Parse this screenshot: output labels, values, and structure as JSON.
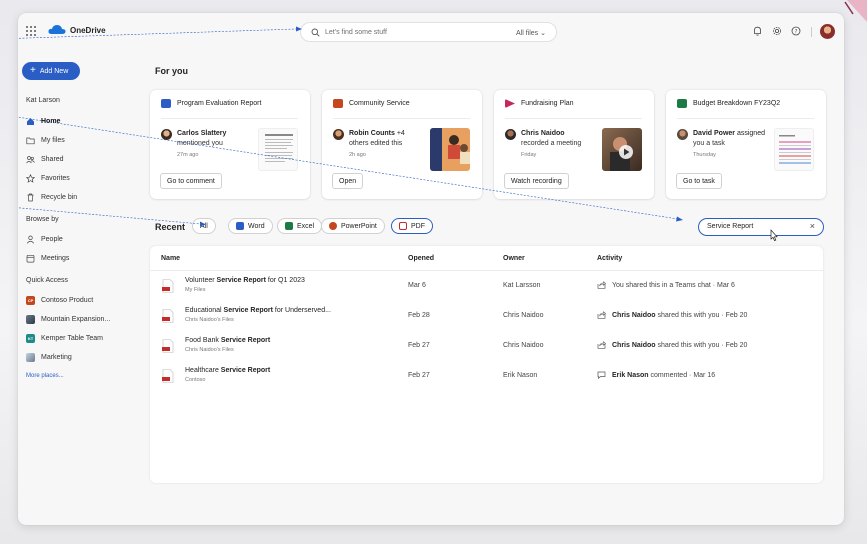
{
  "header": {
    "brand": "OneDrive",
    "search_placeholder": "Let's find some stuff",
    "search_scope": "All files"
  },
  "sidebar": {
    "add_new": "Add New",
    "user": "Kat Larson",
    "items": [
      {
        "label": "Home",
        "icon": "home-icon",
        "active": true
      },
      {
        "label": "My files",
        "icon": "folder-icon"
      },
      {
        "label": "Shared",
        "icon": "people-icon"
      },
      {
        "label": "Favorites",
        "icon": "star-icon"
      },
      {
        "label": "Recycle bin",
        "icon": "trash-icon"
      }
    ],
    "browse_by": "Browse by",
    "browse_items": [
      {
        "label": "People",
        "icon": "person-icon"
      },
      {
        "label": "Meetings",
        "icon": "calendar-icon"
      }
    ],
    "quick_access": "Quick Access",
    "quick_items": [
      {
        "label": "Contoso Product",
        "badge": "CP",
        "color": "#c4471f"
      },
      {
        "label": "Mountain Expansion...",
        "badge": "",
        "color": "#4a5a6a"
      },
      {
        "label": "Kemper Table Team",
        "badge": "KT",
        "color": "#1f8a8a"
      },
      {
        "label": "Marketing",
        "badge": "",
        "color": "#7a8fa8"
      }
    ],
    "more_places": "More places..."
  },
  "for_you": {
    "title": "For you",
    "cards": [
      {
        "title": "Program Evaluation Report",
        "color": "#2b5ec4",
        "person": "Carlos Slattery",
        "action": "mentioned you",
        "time": "27m ago",
        "button": "Go to comment"
      },
      {
        "title": "Community Service",
        "color": "#c4471f",
        "person": "Robin Counts",
        "person_extra": "+4",
        "action": "others edited this",
        "time": "2h ago",
        "button": "Open"
      },
      {
        "title": "Fundraising Plan",
        "color": "#c4295a",
        "person": "Chris Naidoo",
        "action": "recorded a meeting",
        "time": "Friday",
        "button": "Watch recording"
      },
      {
        "title": "Budget Breakdown FY23Q2",
        "color": "#1d7a45",
        "person": "David Power",
        "action_extra": "assigned",
        "action": "you a task",
        "time": "Thursday",
        "button": "Go to task"
      }
    ]
  },
  "recent": {
    "title": "Recent",
    "filters": [
      {
        "label": "All",
        "color": ""
      },
      {
        "label": "Word",
        "color": "#2b5ec4"
      },
      {
        "label": "Excel",
        "color": "#1d7a45"
      },
      {
        "label": "PowerPoint",
        "color": "#c4471f"
      },
      {
        "label": "PDF",
        "color": "#c42b2b",
        "selected": true
      }
    ],
    "filter_value": "Service Report",
    "columns": {
      "name": "Name",
      "opened": "Opened",
      "owner": "Owner",
      "activity": "Activity"
    },
    "rows": [
      {
        "pre": "Volunteer ",
        "bold": "Service Report",
        "post": " for Q1 2023",
        "location": "My Files",
        "opened": "Mar 6",
        "owner": "Kat Larsson",
        "act_icon": "share-icon",
        "act_person": "",
        "activity": "You shared this in a Teams chat · Mar 6"
      },
      {
        "pre": "Educational ",
        "bold": "Service Report",
        "post": " for Underserved...",
        "location": "Chris Naidoo's Files",
        "opened": "Feb 28",
        "owner": "Chris Naidoo",
        "act_icon": "share-icon",
        "act_person": "Chris Naidoo",
        "activity": " shared this with you · Feb 20"
      },
      {
        "pre": "Food Bank ",
        "bold": "Service Report",
        "post": "",
        "location": "Chris Naidoo's Files",
        "opened": "Feb 27",
        "owner": "Chris Naidoo",
        "act_icon": "share-icon",
        "act_person": "Chris Naidoo",
        "activity": " shared this with you · Feb 20"
      },
      {
        "pre": "Healthcare ",
        "bold": "Service Report",
        "post": "",
        "location": "Contoso",
        "opened": "Feb 27",
        "owner": "Erik Nason",
        "act_icon": "comment-icon",
        "act_person": "Erik Nason",
        "activity": " commented · Mar 16"
      }
    ]
  }
}
